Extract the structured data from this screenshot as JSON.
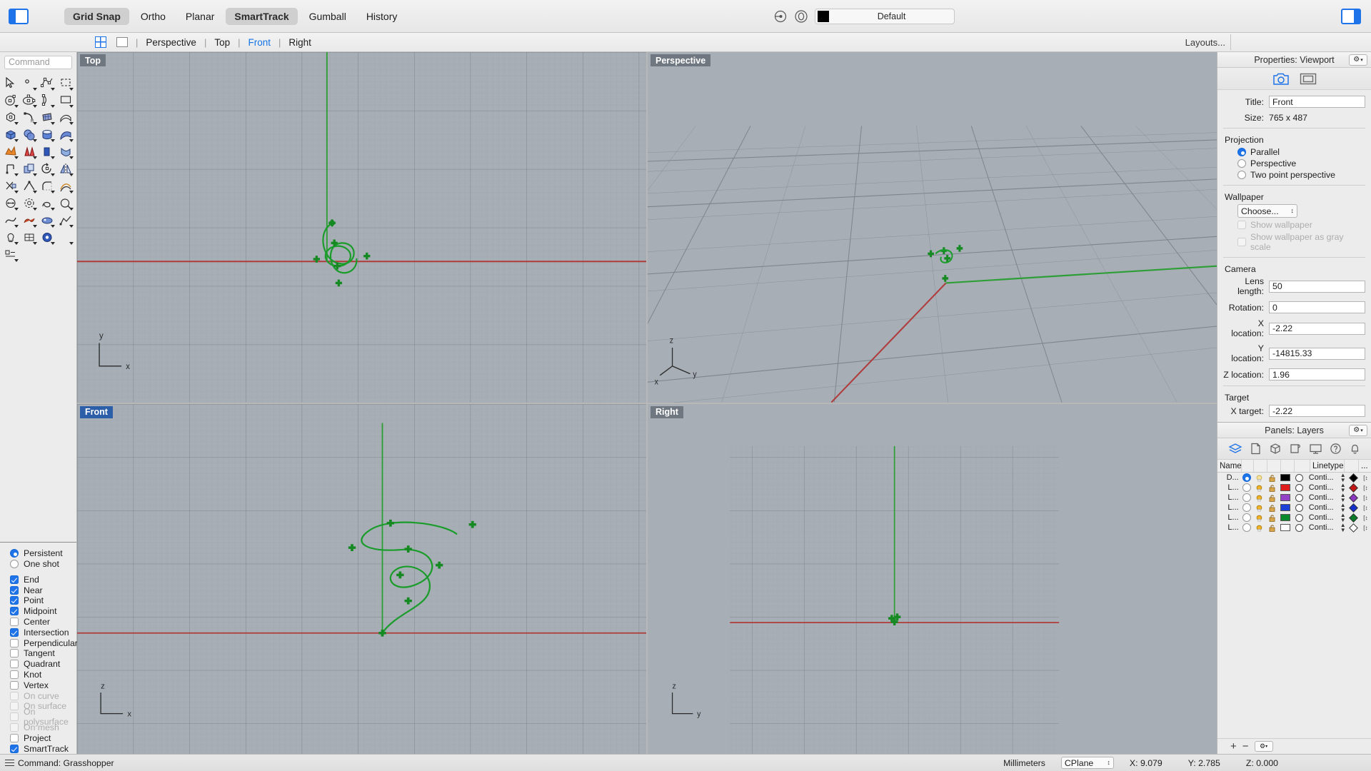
{
  "topbar": {
    "panel_toggle_left": "left-panel-toggle",
    "panel_toggle_right": "right-panel-toggle",
    "modes": [
      {
        "label": "Grid Snap",
        "active": true
      },
      {
        "label": "Ortho",
        "active": false
      },
      {
        "label": "Planar",
        "active": false
      },
      {
        "label": "SmartTrack",
        "active": true
      },
      {
        "label": "Gumball",
        "active": false
      },
      {
        "label": "History",
        "active": false
      }
    ],
    "layer_selector": {
      "name": "Default",
      "color": "#000000"
    }
  },
  "viewbar": {
    "tabs": [
      {
        "label": "Perspective",
        "active": false
      },
      {
        "label": "Top",
        "active": false
      },
      {
        "label": "Front",
        "active": true
      },
      {
        "label": "Right",
        "active": false
      }
    ],
    "separator": "|",
    "layouts_label": "Layouts..."
  },
  "command": {
    "placeholder": "Command",
    "value": ""
  },
  "osnap": {
    "mode": [
      {
        "label": "Persistent",
        "selected": true
      },
      {
        "label": "One shot",
        "selected": false
      }
    ],
    "options": [
      {
        "label": "End",
        "checked": true,
        "enabled": true
      },
      {
        "label": "Near",
        "checked": true,
        "enabled": true
      },
      {
        "label": "Point",
        "checked": true,
        "enabled": true
      },
      {
        "label": "Midpoint",
        "checked": true,
        "enabled": true
      },
      {
        "label": "Center",
        "checked": false,
        "enabled": true
      },
      {
        "label": "Intersection",
        "checked": true,
        "enabled": true
      },
      {
        "label": "Perpendicular",
        "checked": false,
        "enabled": true
      },
      {
        "label": "Tangent",
        "checked": false,
        "enabled": true
      },
      {
        "label": "Quadrant",
        "checked": false,
        "enabled": true
      },
      {
        "label": "Knot",
        "checked": false,
        "enabled": true
      },
      {
        "label": "Vertex",
        "checked": false,
        "enabled": true
      },
      {
        "label": "On curve",
        "checked": false,
        "enabled": false
      },
      {
        "label": "On surface",
        "checked": false,
        "enabled": false
      },
      {
        "label": "On polysurface",
        "checked": false,
        "enabled": false
      },
      {
        "label": "On mesh",
        "checked": false,
        "enabled": false
      },
      {
        "label": "Project",
        "checked": false,
        "enabled": true
      },
      {
        "label": "SmartTrack",
        "checked": true,
        "enabled": true
      }
    ]
  },
  "viewports": [
    {
      "name": "Top",
      "selected": false,
      "axis_x": "x",
      "axis_y": "y"
    },
    {
      "name": "Perspective",
      "selected": false,
      "axis_x": "x",
      "axis_y": "y",
      "axis_z": "z"
    },
    {
      "name": "Front",
      "selected": true,
      "axis_x": "x",
      "axis_z": "z"
    },
    {
      "name": "Right",
      "selected": false,
      "axis_y": "y",
      "axis_z": "z"
    }
  ],
  "properties": {
    "header": "Properties: Viewport",
    "gear_label": "⚙",
    "tabs": [
      {
        "name": "camera-icon",
        "active": true
      },
      {
        "name": "viewport-icon",
        "active": false
      }
    ],
    "title_label": "Title:",
    "title_value": "Front",
    "size_label": "Size:",
    "size_value": "765 x 487",
    "projection_group": "Projection",
    "projection_options": [
      {
        "label": "Parallel",
        "selected": true
      },
      {
        "label": "Perspective",
        "selected": false
      },
      {
        "label": "Two point perspective",
        "selected": false
      }
    ],
    "wallpaper_group": "Wallpaper",
    "wallpaper_choose": "Choose...",
    "wallpaper_checks": [
      {
        "label": "Show wallpaper",
        "checked": false,
        "enabled": false
      },
      {
        "label": "Show wallpaper as gray scale",
        "checked": false,
        "enabled": false
      }
    ],
    "camera_group": "Camera",
    "camera_fields": [
      {
        "label": "Lens length:",
        "value": "50"
      },
      {
        "label": "Rotation:",
        "value": "0"
      },
      {
        "label": "X location:",
        "value": "-2.22"
      },
      {
        "label": "Y location:",
        "value": "-14815.33"
      },
      {
        "label": "Z location:",
        "value": "1.96"
      }
    ],
    "target_group": "Target",
    "target_fields": [
      {
        "label": "X target:",
        "value": "-2.22"
      }
    ]
  },
  "layers": {
    "header": "Panels: Layers",
    "gear_label": "⚙",
    "tab_icons": [
      "layers-icon",
      "page-icon",
      "cube-icon",
      "scroll-icon",
      "display-icon",
      "help-icon",
      "bell-icon"
    ],
    "columns": [
      "Name",
      "",
      "",
      "",
      "",
      "",
      "Linetype",
      "",
      "..."
    ],
    "rows": [
      {
        "name": "D...",
        "current": true,
        "color": "#000000",
        "linetype": "Conti...",
        "print_color": "#000000"
      },
      {
        "name": "L...",
        "current": false,
        "color": "#e01b1b",
        "linetype": "Conti...",
        "print_color": "#c41515"
      },
      {
        "name": "L...",
        "current": false,
        "color": "#9340c9",
        "linetype": "Conti...",
        "print_color": "#8b35c0"
      },
      {
        "name": "L...",
        "current": false,
        "color": "#1c3fd8",
        "linetype": "Conti...",
        "print_color": "#1430cc"
      },
      {
        "name": "L...",
        "current": false,
        "color": "#0c8a2e",
        "linetype": "Conti...",
        "print_color": "#097a27"
      },
      {
        "name": "L...",
        "current": false,
        "color": "#ffffff",
        "linetype": "Conti...",
        "print_color": "#ffffff"
      }
    ],
    "footer_buttons": [
      "add-layer-button",
      "remove-layer-button",
      "layer-options-button"
    ]
  },
  "statusbar": {
    "command_text": "Command: Grasshopper",
    "units": "Millimeters",
    "cplane": "CPlane",
    "x": "X: 9.079",
    "y": "Y: 2.785",
    "z": "Z: 0.000"
  }
}
